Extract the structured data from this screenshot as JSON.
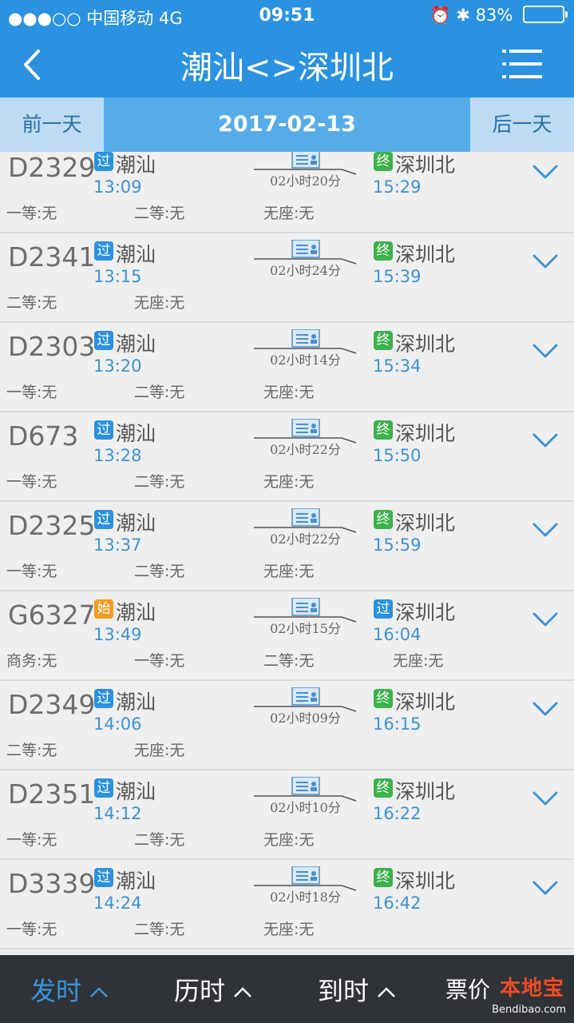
{
  "status_bar": {
    "carrier": "●●●○○ 中国移动  4G",
    "time": "09:51",
    "right_icons": "⏰ ✱ 83%",
    "battery_percent": 83
  },
  "nav": {
    "title": "潮汕<>深圳北",
    "back_icon": "chevron-left-icon",
    "menu_icon": "menu-icon"
  },
  "date_bar": {
    "prev_label": "前一天",
    "date": "2017-02-13",
    "next_label": "后一天"
  },
  "colors": {
    "primary": "#2a92e0",
    "pass_badge": "#2a92e0",
    "terminal_badge": "#3bb24a",
    "start_badge": "#f29a1c",
    "time_text": "#3c93d6"
  },
  "trains": [
    {
      "number": "D2329",
      "from_badge": "过",
      "from": "潮汕",
      "dep": "13:09",
      "duration": "02小时20分",
      "to_badge": "终",
      "to": "深圳北",
      "arr": "15:29",
      "seats": [
        "一等:无",
        "二等:无",
        "无座:无"
      ]
    },
    {
      "number": "D2341",
      "from_badge": "过",
      "from": "潮汕",
      "dep": "13:15",
      "duration": "02小时24分",
      "to_badge": "终",
      "to": "深圳北",
      "arr": "15:39",
      "seats": [
        "二等:无",
        "无座:无"
      ]
    },
    {
      "number": "D2303",
      "from_badge": "过",
      "from": "潮汕",
      "dep": "13:20",
      "duration": "02小时14分",
      "to_badge": "终",
      "to": "深圳北",
      "arr": "15:34",
      "seats": [
        "一等:无",
        "二等:无",
        "无座:无"
      ]
    },
    {
      "number": "D673",
      "from_badge": "过",
      "from": "潮汕",
      "dep": "13:28",
      "duration": "02小时22分",
      "to_badge": "终",
      "to": "深圳北",
      "arr": "15:50",
      "seats": [
        "一等:无",
        "二等:无",
        "无座:无"
      ]
    },
    {
      "number": "D2325",
      "from_badge": "过",
      "from": "潮汕",
      "dep": "13:37",
      "duration": "02小时22分",
      "to_badge": "终",
      "to": "深圳北",
      "arr": "15:59",
      "seats": [
        "一等:无",
        "二等:无",
        "无座:无"
      ]
    },
    {
      "number": "G6327",
      "from_badge": "始",
      "from": "潮汕",
      "dep": "13:49",
      "duration": "02小时15分",
      "to_badge": "过",
      "to": "深圳北",
      "arr": "16:04",
      "seats": [
        "商务:无",
        "一等:无",
        "二等:无",
        "无座:无"
      ]
    },
    {
      "number": "D2349",
      "from_badge": "过",
      "from": "潮汕",
      "dep": "14:06",
      "duration": "02小时09分",
      "to_badge": "终",
      "to": "深圳北",
      "arr": "16:15",
      "seats": [
        "二等:无",
        "无座:无"
      ]
    },
    {
      "number": "D2351",
      "from_badge": "过",
      "from": "潮汕",
      "dep": "14:12",
      "duration": "02小时10分",
      "to_badge": "终",
      "to": "深圳北",
      "arr": "16:22",
      "seats": [
        "一等:无",
        "二等:无",
        "无座:无"
      ]
    },
    {
      "number": "D3339",
      "from_badge": "过",
      "from": "潮汕",
      "dep": "14:24",
      "duration": "02小时18分",
      "to_badge": "终",
      "to": "深圳北",
      "arr": "16:42",
      "seats": [
        "一等:无",
        "二等:无",
        "无座:无"
      ]
    }
  ],
  "bottom_tabs": [
    {
      "label": "发时",
      "active": true
    },
    {
      "label": "历时",
      "active": false
    },
    {
      "label": "到时",
      "active": false
    },
    {
      "label": "票价",
      "active": false
    }
  ],
  "watermark": {
    "logo": "本地宝",
    "url": "Bendibao.com"
  }
}
